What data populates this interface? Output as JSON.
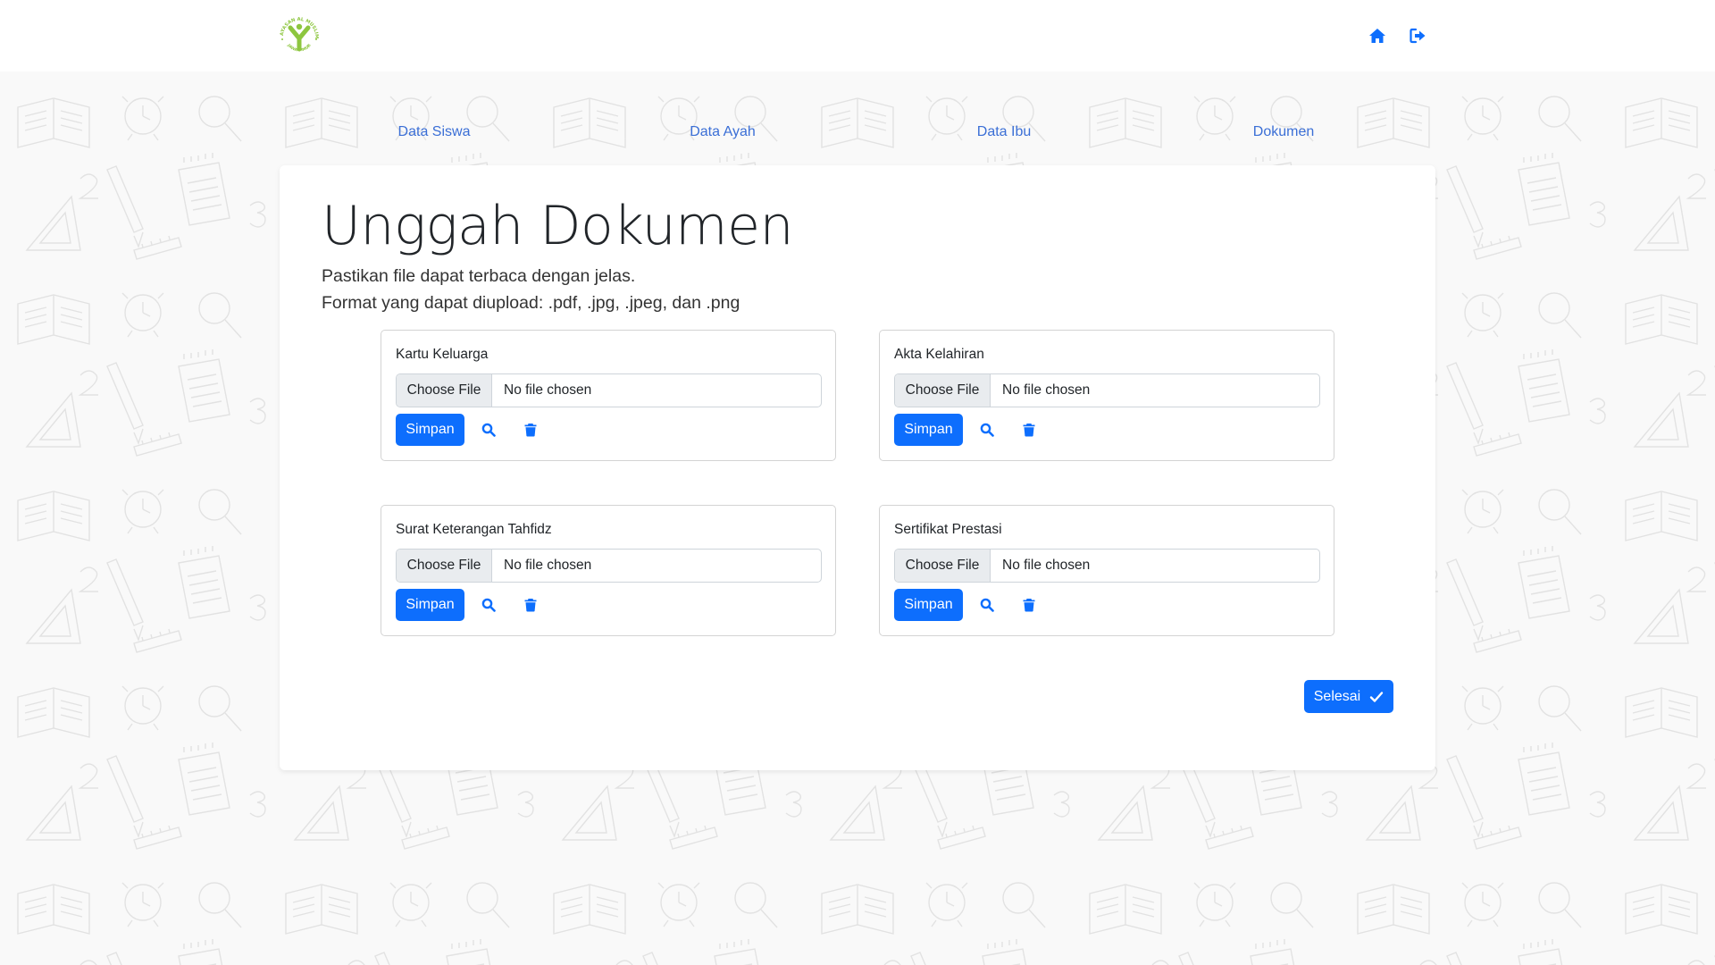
{
  "header": {
    "logo": {
      "text_top": "YAYASAN AL MUSLIM",
      "text_bottom": "JAWA TIMUR",
      "color": "#8dc63f"
    },
    "icons": [
      {
        "name": "home-icon",
        "label": "Home"
      },
      {
        "name": "logout-icon",
        "label": "Logout"
      }
    ],
    "accent": "#0d6efd"
  },
  "nav": {
    "tabs": [
      {
        "label": "Data Siswa"
      },
      {
        "label": "Data Ayah"
      },
      {
        "label": "Data Ibu"
      },
      {
        "label": "Dokumen"
      }
    ],
    "link_color": "#3b6fd6"
  },
  "main": {
    "title": "Unggah Dokumen",
    "description_lines": [
      "Pastikan file dapat terbaca dengan jelas.",
      "Format yang dapat diupload: .pdf, .jpg, .jpeg, dan .png"
    ],
    "documents": [
      {
        "label": "Kartu Keluarga",
        "choose_label": "Choose File",
        "file_status": "No file chosen",
        "save_label": "Simpan"
      },
      {
        "label": "Akta Kelahiran",
        "choose_label": "Choose File",
        "file_status": "No file chosen",
        "save_label": "Simpan"
      },
      {
        "label": "Surat Keterangan Tahfidz",
        "choose_label": "Choose File",
        "file_status": "No file chosen",
        "save_label": "Simpan"
      },
      {
        "label": "Sertifikat Prestasi",
        "choose_label": "Choose File",
        "file_status": "No file chosen",
        "save_label": "Simpan"
      }
    ],
    "done_label": "Selesai",
    "primary_color": "#0d6efd"
  }
}
